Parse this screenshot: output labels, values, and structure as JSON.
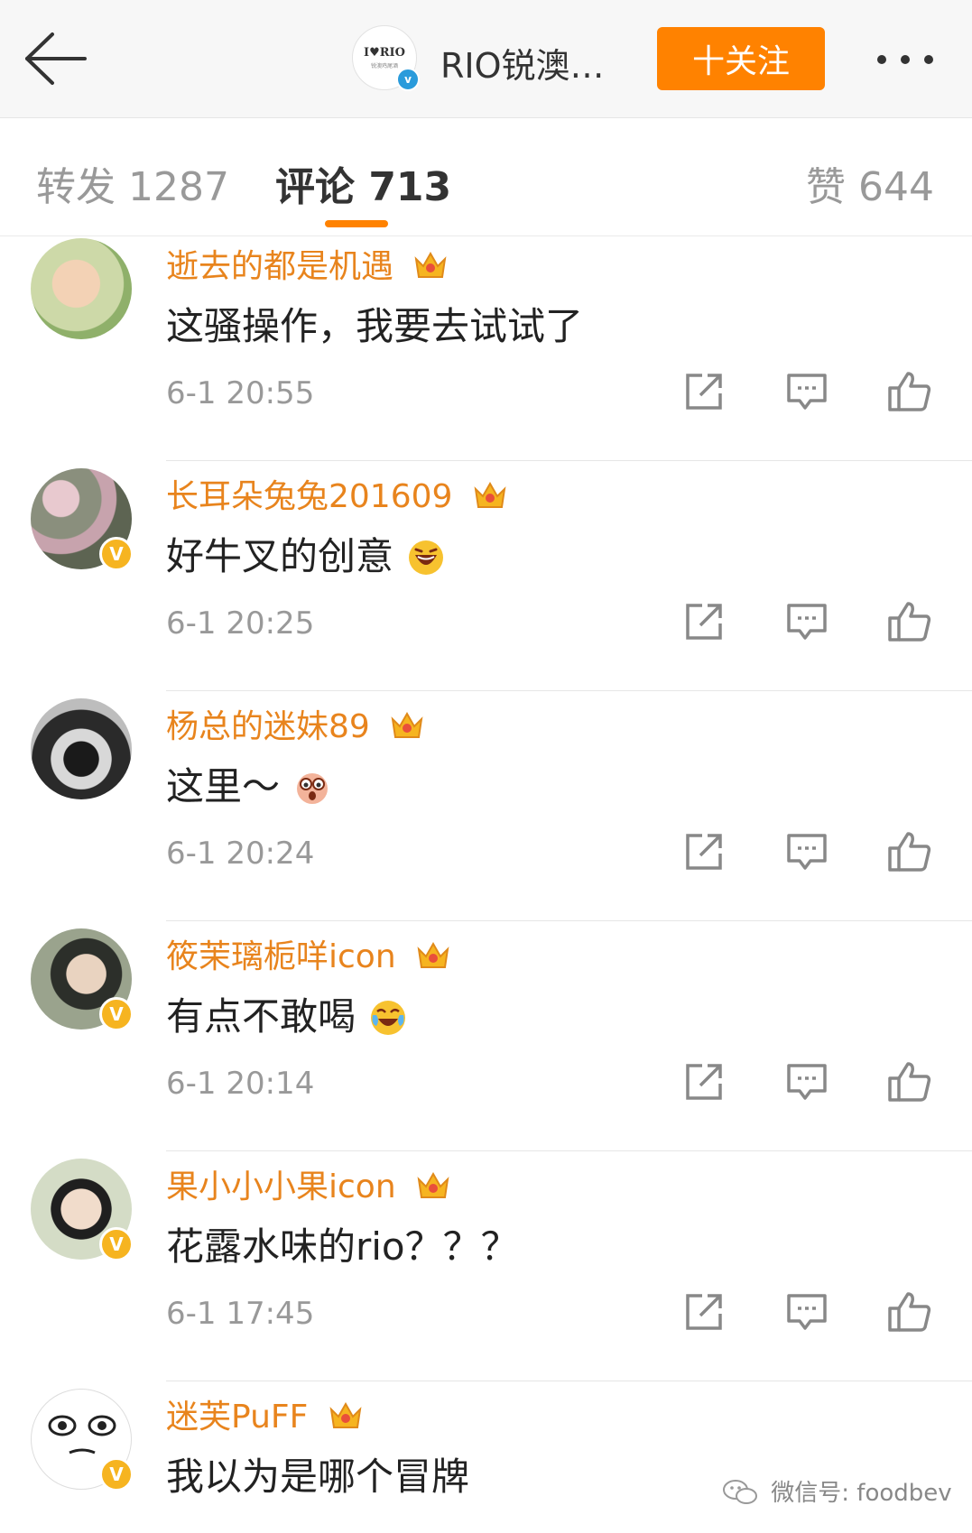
{
  "header": {
    "account_name": "RIO锐澳…",
    "logo_text": "I♥RIO",
    "logo_sub": "锐澳鸡尾酒",
    "verified_mark": "v",
    "follow_label": "十关注"
  },
  "tabs": {
    "repost": "转发 1287",
    "comment": "评论 713",
    "like": "赞 644"
  },
  "comments": [
    {
      "user": "逝去的都是机遇",
      "text": "这骚操作，我要去试试了",
      "time": "6-1 20:55",
      "verified": false,
      "emoji": ""
    },
    {
      "user": "长耳朵兔兔201609",
      "text": "好牛叉的创意",
      "time": "6-1 20:25",
      "verified": true,
      "emoji": "laugh"
    },
    {
      "user": "杨总的迷妹89",
      "text": "这里～",
      "time": "6-1 20:24",
      "verified": false,
      "emoji": "shock"
    },
    {
      "user": "筱茉璃栀咩icon",
      "text": "有点不敢喝",
      "time": "6-1 20:14",
      "verified": true,
      "emoji": "cry-laugh"
    },
    {
      "user": "果小小小果icon",
      "text": "花露水味的rio？？？",
      "time": "6-1 17:45",
      "verified": true,
      "emoji": ""
    },
    {
      "user": "迷芙PuFF",
      "text": "我以为是哪个冒牌",
      "time": "",
      "verified": true,
      "emoji": ""
    }
  ],
  "verified_badge_text": "V",
  "watermark": "微信号: foodbev",
  "colors": {
    "accent": "#ff8200",
    "username": "#e8841d",
    "verified_gold": "#f6b420",
    "verified_blue": "#2a9bdb"
  }
}
